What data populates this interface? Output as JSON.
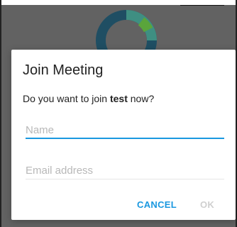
{
  "dialog": {
    "title": "Join Meeting",
    "message_prefix": "Do you want to join ",
    "meeting_name": "test",
    "message_suffix": " now?",
    "name_placeholder": "Name",
    "email_placeholder": "Email address",
    "cancel_label": "CANCEL",
    "ok_label": "OK"
  },
  "colors": {
    "accent": "#1a98e0",
    "scrim": "#626262",
    "disabled_text": "#cfcfcf"
  },
  "icons": {
    "background_logo": "ring-logo-icon"
  }
}
